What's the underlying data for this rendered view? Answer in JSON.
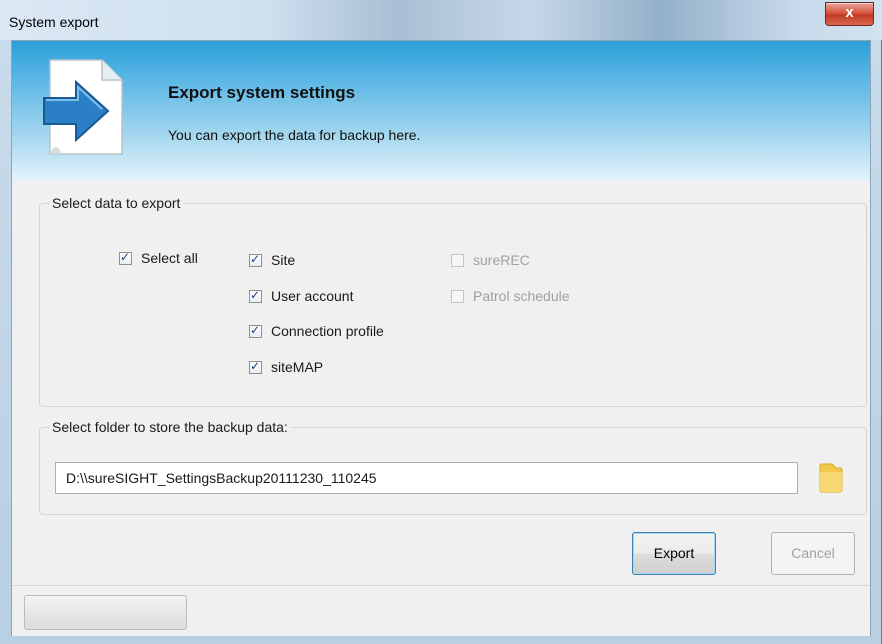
{
  "window": {
    "title": "System export",
    "close_glyph": "x"
  },
  "header": {
    "icon": "export-arrow-document-icon",
    "title": "Export system settings",
    "subtitle": "You can export the data for backup here."
  },
  "select_group": {
    "label": "Select data to export",
    "select_all": {
      "label": "Select all",
      "checked": true
    },
    "items": [
      {
        "label": "Site",
        "checked": true,
        "enabled": true
      },
      {
        "label": "User account",
        "checked": true,
        "enabled": true
      },
      {
        "label": "Connection profile",
        "checked": true,
        "enabled": true
      },
      {
        "label": "siteMAP",
        "checked": true,
        "enabled": true
      },
      {
        "label": "sureREC",
        "checked": false,
        "enabled": false
      },
      {
        "label": "Patrol schedule",
        "checked": false,
        "enabled": false
      }
    ]
  },
  "folder_group": {
    "label": "Select folder to store the backup data:",
    "path": "D:\\\\sureSIGHT_SettingsBackup20111230_110245",
    "browse_icon": "folder-icon"
  },
  "buttons": {
    "export": "Export",
    "cancel": "Cancel"
  },
  "colors": {
    "banner_top": "#2a9fd9",
    "close_red": "#c23a25",
    "disabled_text": "#a0a0a0"
  }
}
